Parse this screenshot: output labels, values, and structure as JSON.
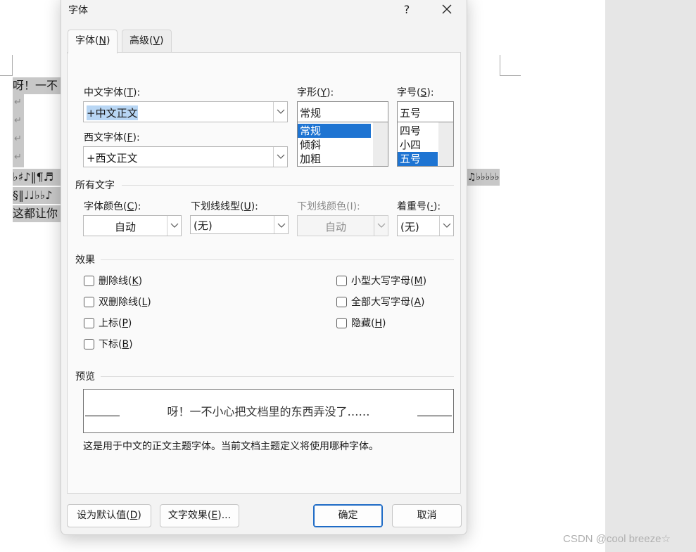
{
  "document": {
    "line1": "呀！一不",
    "line_symbols": "♭♯♪‖¶♬",
    "line_symbols_right": "♫♭♭♭♭♭",
    "line_section": "§‖♩♩♭♭♪",
    "line_last": "这都让你",
    "para_mark": "↵"
  },
  "dialog": {
    "title": "字体",
    "help": "?",
    "tabs": [
      {
        "label": "字体(",
        "key": "N",
        "end": ")"
      },
      {
        "label": "高级(",
        "key": "V",
        "end": ")"
      }
    ],
    "chinese_font": {
      "label": "中文字体(",
      "key": "T",
      "end": "):",
      "value": "+中文正文"
    },
    "western_font": {
      "label": "西文字体(",
      "key": "F",
      "end": "):",
      "value": "+西文正文"
    },
    "style": {
      "label": "字形(",
      "key": "Y",
      "end": "):",
      "value": "常规",
      "options": [
        "常规",
        "倾斜",
        "加粗"
      ],
      "selected": 0
    },
    "size": {
      "label": "字号(",
      "key": "S",
      "end": "):",
      "value": "五号",
      "options": [
        "四号",
        "小四",
        "五号"
      ],
      "selected": 2
    },
    "all_text_section": "所有文字",
    "font_color": {
      "label": "字体颜色(",
      "key": "C",
      "end": "):",
      "value": "自动"
    },
    "underline_style": {
      "label": "下划线线型(",
      "key": "U",
      "end": "):",
      "value": "(无)"
    },
    "underline_color": {
      "label": "下划线颜色(I):",
      "value": "自动"
    },
    "emphasis_mark": {
      "label": "着重号(",
      "key": "·",
      "end": "):",
      "value": "(无)"
    },
    "effects_section": "效果",
    "effects": {
      "strikethrough": {
        "label": "删除线(",
        "key": "K",
        "end": ")"
      },
      "double_strikethrough": {
        "label": "双删除线(",
        "key": "L",
        "end": ")"
      },
      "superscript": {
        "label": "上标(",
        "key": "P",
        "end": ")"
      },
      "subscript": {
        "label": "下标(",
        "key": "B",
        "end": ")"
      },
      "small_caps": {
        "label": "小型大写字母(",
        "key": "M",
        "end": ")"
      },
      "all_caps": {
        "label": "全部大写字母(",
        "key": "A",
        "end": ")"
      },
      "hidden": {
        "label": "隐藏(",
        "key": "H",
        "end": ")"
      }
    },
    "preview_section": "预览",
    "preview_text": "呀！一不小心把文档里的东西弄没了……",
    "description": "这是用于中文的正文主题字体。当前文档主题定义将使用哪种字体。",
    "buttons": {
      "set_default": {
        "label": "设为默认值(",
        "key": "D",
        "end": ")"
      },
      "text_effects": {
        "label": "文字效果(",
        "key": "E",
        "end": ")..."
      },
      "ok": "确定",
      "cancel": "取消"
    }
  },
  "watermark": "CSDN @cool breeze☆",
  "colors": {
    "selection": "#1e74d2",
    "text_highlight": "#b8d6f4",
    "primary_border": "#1e6bc6"
  }
}
